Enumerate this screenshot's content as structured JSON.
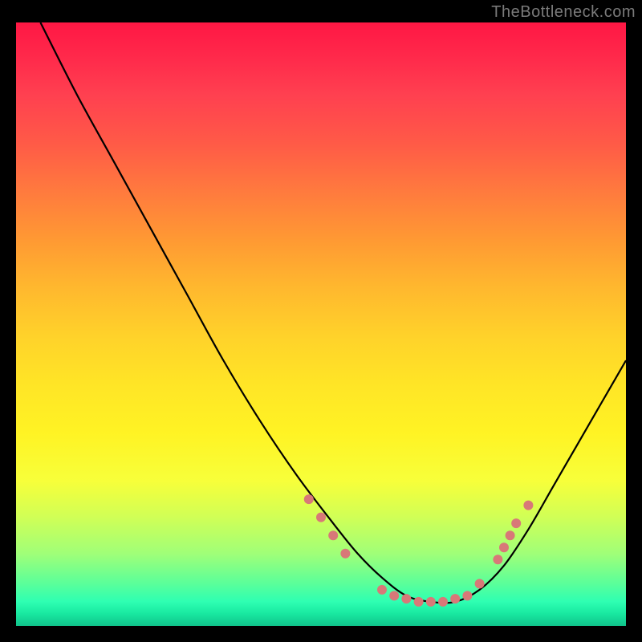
{
  "watermark": "TheBottleneck.com",
  "chart_data": {
    "type": "line",
    "title": "",
    "xlabel": "",
    "ylabel": "",
    "xlim": [
      0,
      100
    ],
    "ylim": [
      0,
      100
    ],
    "gradient_colors": {
      "top": "#ff1744",
      "mid": "#ffe526",
      "bottom": "#10c28a"
    },
    "series": [
      {
        "name": "bottleneck-curve",
        "x": [
          4,
          10,
          16,
          22,
          28,
          34,
          40,
          46,
          52,
          56,
          60,
          64,
          68,
          72,
          76,
          80,
          84,
          88,
          92,
          96,
          100
        ],
        "y": [
          100,
          88,
          77,
          66,
          55,
          44,
          34,
          25,
          17,
          12,
          8,
          5,
          4,
          4,
          6,
          10,
          16,
          23,
          30,
          37,
          44
        ]
      }
    ],
    "markers": {
      "name": "data-points",
      "color": "#d87878",
      "radius_px": 6,
      "points": [
        {
          "x": 48,
          "y": 21
        },
        {
          "x": 50,
          "y": 18
        },
        {
          "x": 52,
          "y": 15
        },
        {
          "x": 54,
          "y": 12
        },
        {
          "x": 60,
          "y": 6
        },
        {
          "x": 62,
          "y": 5
        },
        {
          "x": 64,
          "y": 4.5
        },
        {
          "x": 66,
          "y": 4
        },
        {
          "x": 68,
          "y": 4
        },
        {
          "x": 70,
          "y": 4
        },
        {
          "x": 72,
          "y": 4.5
        },
        {
          "x": 74,
          "y": 5
        },
        {
          "x": 76,
          "y": 7
        },
        {
          "x": 79,
          "y": 11
        },
        {
          "x": 80,
          "y": 13
        },
        {
          "x": 81,
          "y": 15
        },
        {
          "x": 82,
          "y": 17
        },
        {
          "x": 84,
          "y": 20
        }
      ]
    }
  }
}
